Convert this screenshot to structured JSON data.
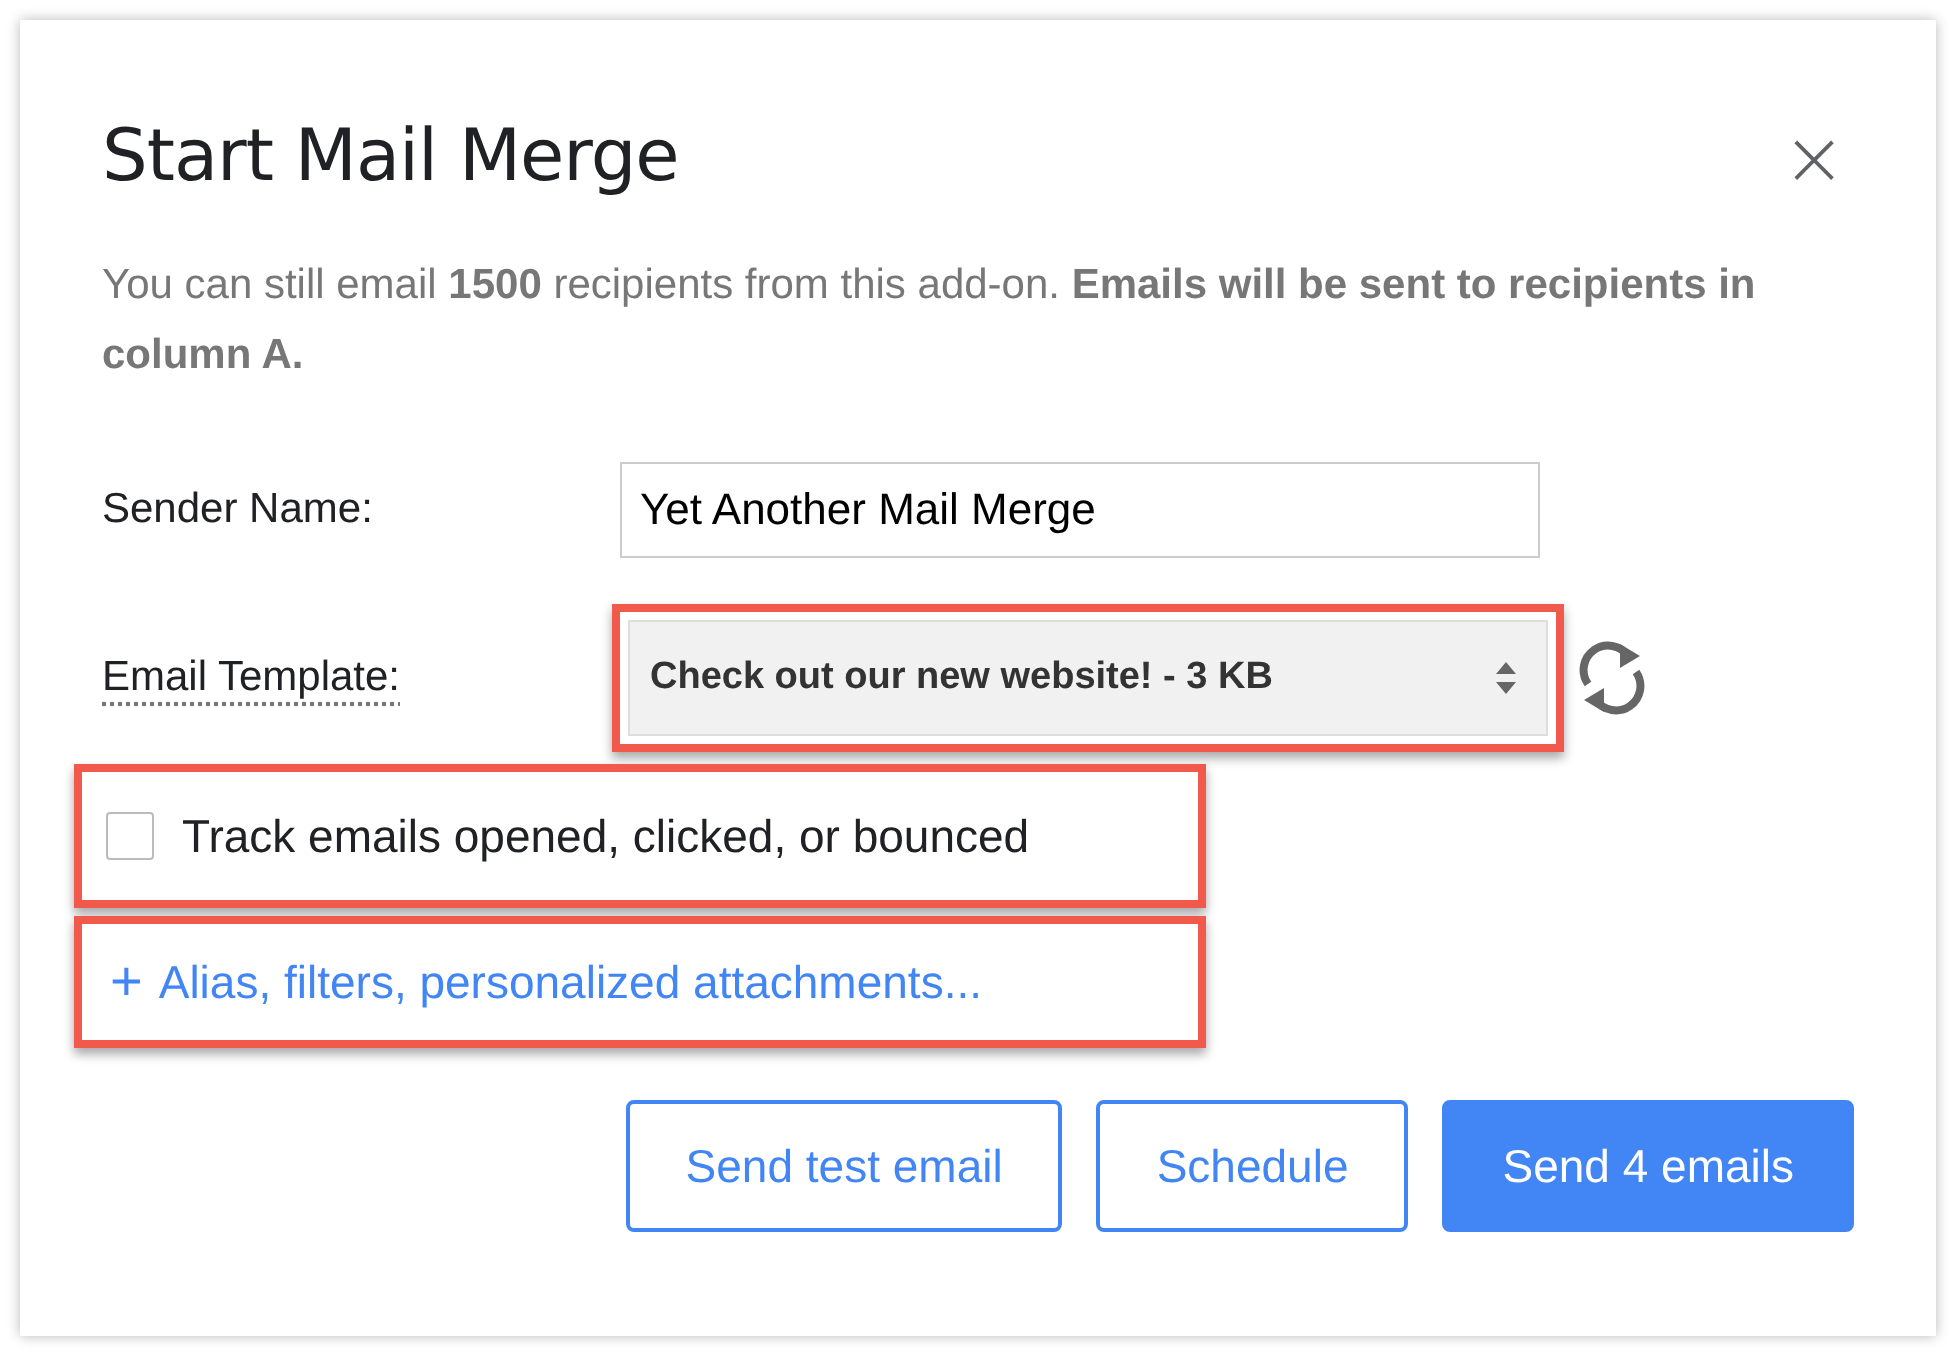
{
  "dialog": {
    "title": "Start Mail Merge",
    "close_icon": "×"
  },
  "notice": "You can still email **1500** recipients from this add-on. **Emails will be sent to recipients in column A.**",
  "sender": {
    "label": "Sender Name:",
    "value": "Yet Another Mail Merge"
  },
  "template": {
    "label": "Email Template:",
    "value": "Check out our new website! - 3 KB",
    "highlighted": true
  },
  "tracking": {
    "label": "Track emails opened, clicked, or bounced",
    "checked": false,
    "highlighted": true
  },
  "options_link": {
    "icon": "+",
    "label": "Alias, filters, personalized attachments...",
    "highlighted": true
  },
  "buttons": [
    {
      "label": "Send test email",
      "kind": "outline"
    },
    {
      "label": "Schedule",
      "kind": "outline"
    },
    {
      "label": "Send 4 emails",
      "kind": "primary"
    }
  ]
}
